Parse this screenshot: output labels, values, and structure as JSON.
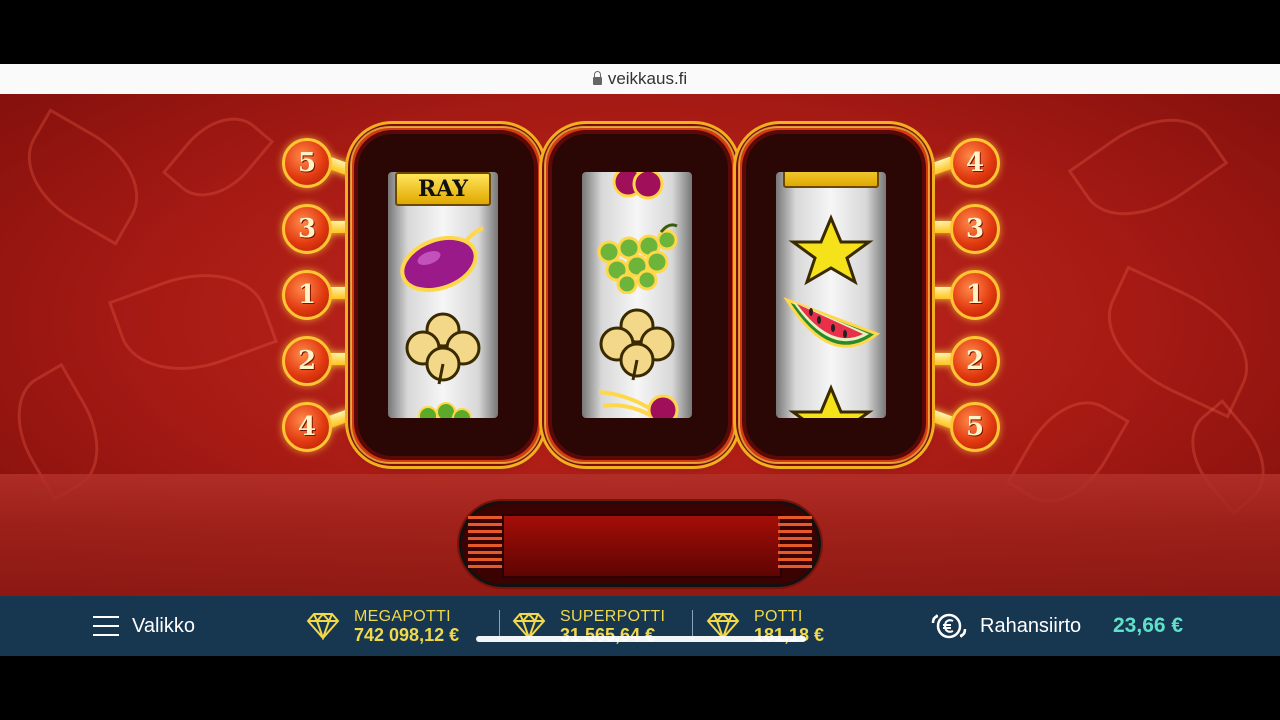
{
  "browser": {
    "url": "veikkaus.fi"
  },
  "game": {
    "paylines_left": [
      "5",
      "3",
      "1",
      "2",
      "4"
    ],
    "paylines_right": [
      "4",
      "3",
      "1",
      "2",
      "5"
    ],
    "reels": [
      {
        "symbols": [
          "ray-bar",
          "plum",
          "clover",
          "grapes"
        ],
        "bar_text": "RAY"
      },
      {
        "symbols": [
          "cherries",
          "grapes",
          "clover",
          "cherries"
        ]
      },
      {
        "symbols": [
          "bar",
          "star",
          "watermelon",
          "star"
        ]
      }
    ],
    "win_display": ""
  },
  "bottom_bar": {
    "menu_label": "Valikko",
    "jackpots": [
      {
        "label": "MEGAPOTTI",
        "value": "742 098,12 €",
        "icon": "diamond-icon"
      },
      {
        "label": "SUPERPOTTI",
        "value": "31 565,64 €",
        "icon": "diamond-icon"
      },
      {
        "label": "POTTI",
        "value": "181,18 €",
        "icon": "diamond-icon"
      }
    ],
    "transfer_label": "Rahansiirto",
    "balance": "23,66 €"
  },
  "colors": {
    "navbar": "#173650",
    "jackpot_text": "#f2d94a",
    "balance": "#5fe0c8",
    "game_bg": "#a61a14"
  }
}
